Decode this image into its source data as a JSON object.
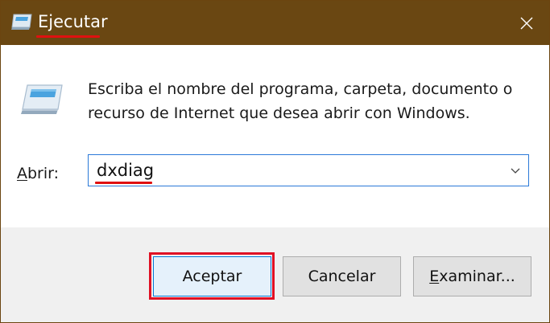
{
  "window": {
    "title": "Ejecutar",
    "close_icon": "close-icon",
    "title_icon": "run-icon"
  },
  "dialog": {
    "icon": "run-icon",
    "description_line1": "Escriba el nombre del programa, carpeta, documento o",
    "description_line2": "recurso de Internet que desea abrir con Windows."
  },
  "open_field": {
    "label_accesskey": "A",
    "label_rest": "brir:",
    "value": "dxdiag",
    "dropdown_icon": "chevron-down-icon"
  },
  "buttons": {
    "accept": "Aceptar",
    "cancel": "Cancelar",
    "browse_accesskey": "E",
    "browse_rest": "xaminar..."
  },
  "colors": {
    "titlebar": "#6a4712",
    "highlight": "#e01024",
    "focus_border": "#0078d7"
  }
}
